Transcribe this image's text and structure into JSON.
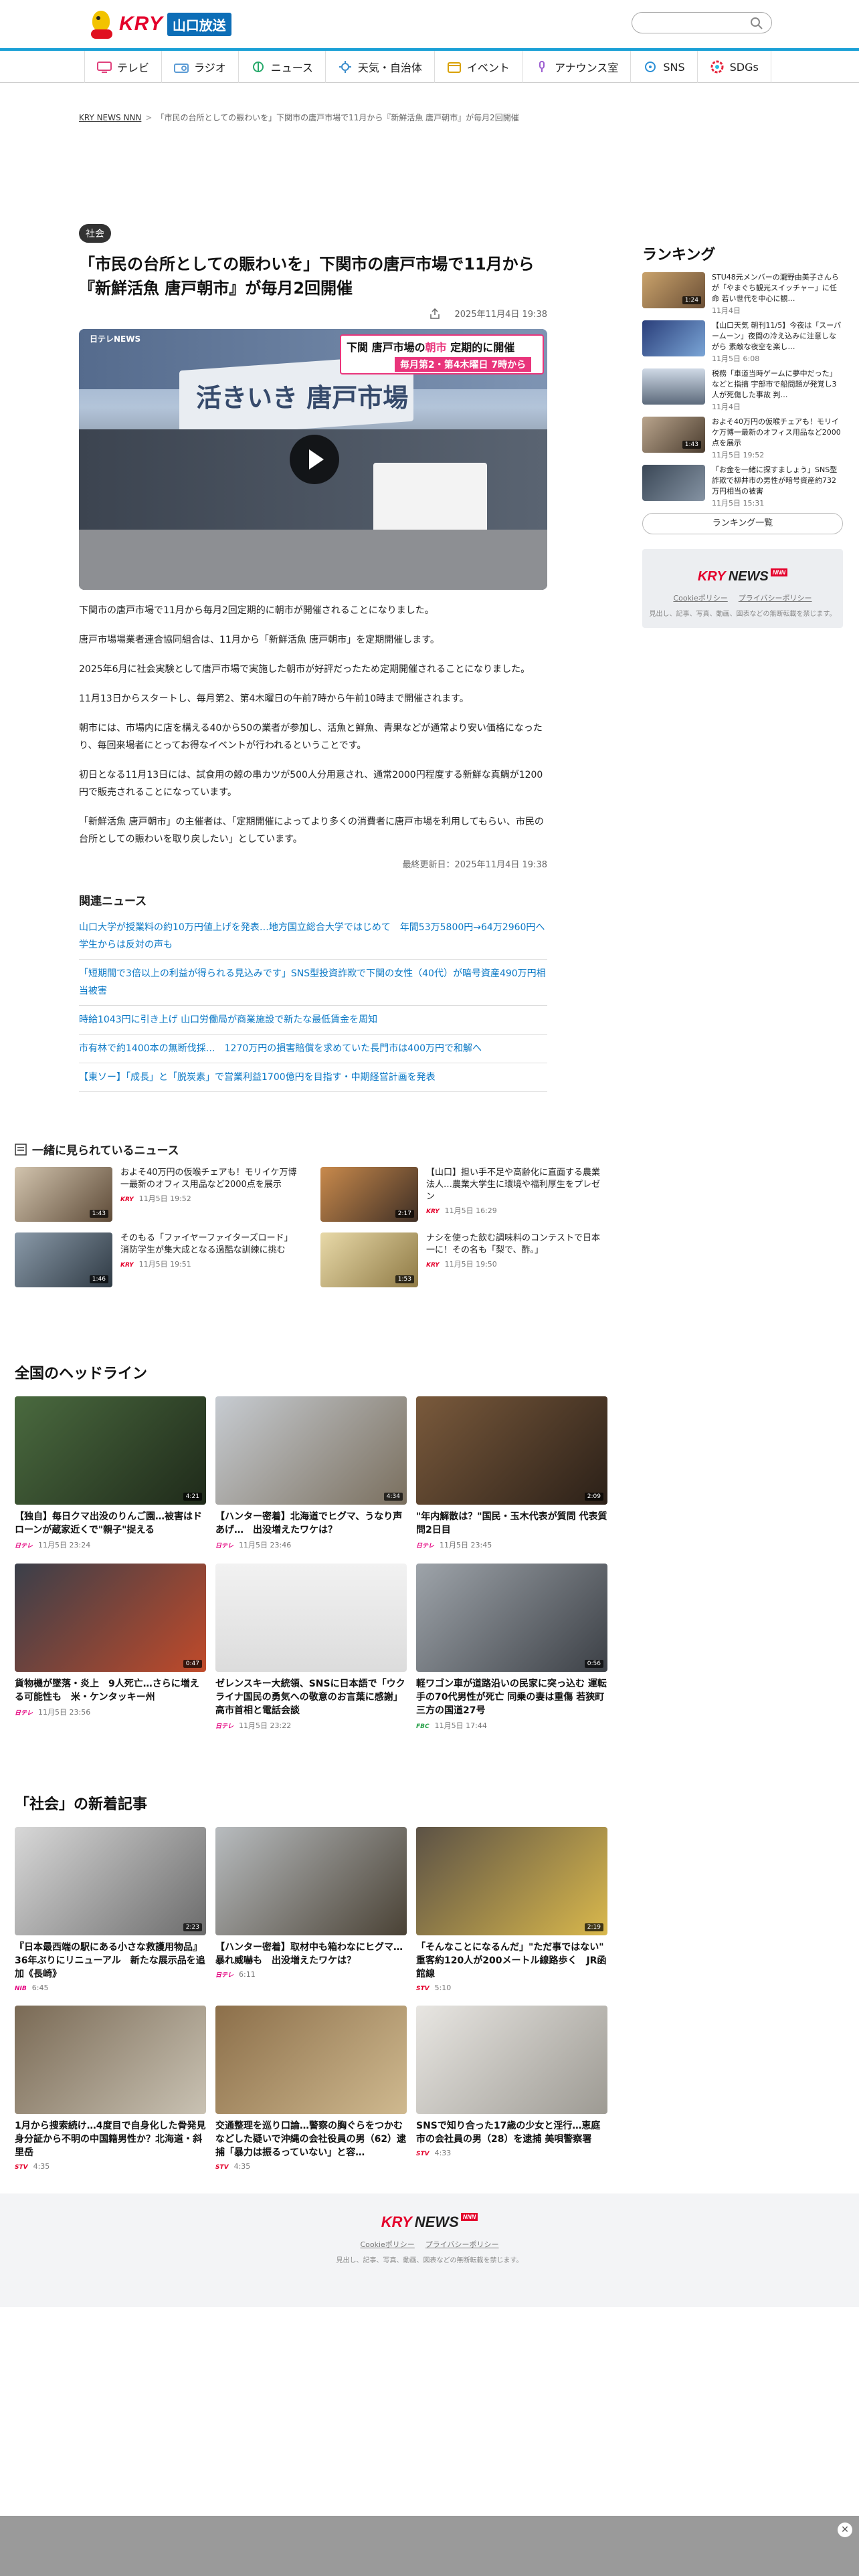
{
  "header": {
    "logo_text": "KRY",
    "logo_sub": "山口放送",
    "search_placeholder": ""
  },
  "nav": [
    {
      "label": "テレビ",
      "icon": "tv-icon"
    },
    {
      "label": "ラジオ",
      "icon": "radio-icon"
    },
    {
      "label": "ニュース",
      "icon": "news-icon"
    },
    {
      "label": "天気・自治体",
      "icon": "weather-icon"
    },
    {
      "label": "イベント",
      "icon": "event-icon"
    },
    {
      "label": "アナウンス室",
      "icon": "mic-icon"
    },
    {
      "label": "SNS",
      "icon": "sns-icon"
    },
    {
      "label": "SDGs",
      "icon": "sdgs-icon"
    }
  ],
  "breadcrumb": {
    "home": "KRY NEWS NNN",
    "current": "「市民の台所としての賑わいを」下関市の唐戸市場で11月から『新鮮活魚 唐戸朝市』が毎月2回開催"
  },
  "article": {
    "category": "社会",
    "title": "「市民の台所としての賑わいを」下関市の唐戸市場で11月から『新鮮活魚 唐戸朝市』が毎月2回開催",
    "date": "2025年11月4日 19:38",
    "video": {
      "brand": "日テレNEWS",
      "sign_text": "活きいき 唐戸市場",
      "banner_prefix": "唐戸市場の",
      "banner_highlight": "朝市",
      "banner_suffix": "定期的に開催",
      "banner_sub": "毎月第2・第4木曜日 7時から",
      "banner_tag": "下関"
    },
    "paragraphs": [
      "下関市の唐戸市場で11月から毎月2回定期的に朝市が開催されることになりました。",
      "唐戸市場場業者連合協同組合は、11月から「新鮮活魚 唐戸朝市」を定期開催します。",
      "2025年6月に社会実験として唐戸市場で実施した朝市が好評だったため定期開催されることになりました。",
      "11月13日からスタートし、毎月第2、第4木曜日の午前7時から午前10時まで開催されます。",
      "朝市には、市場内に店を構える40から50の業者が参加し、活魚と鮮魚、青果などが通常より安い価格になったり、毎回来場者にとってお得なイベントが行われるということです。",
      "初日となる11月13日には、試食用の鯨の串カツが500人分用意され、通常2000円程度する新鮮な真鯛が1200円で販売されることになっています。",
      "「新鮮活魚 唐戸朝市」の主催者は、「定期開催によってより多くの消費者に唐戸市場を利用してもらい、市民の台所としての賑わいを取り戻したい」としています。"
    ],
    "updated": "最終更新日：2025年11月4日 19:38"
  },
  "related": {
    "heading": "関連ニュース",
    "items": [
      "山口大学が授業料の約10万円値上げを発表…地方国立総合大学ではじめて　年間53万5800円→64万2960円へ　学生からは反対の声も",
      "「短期間で3倍以上の利益が得られる見込みです」SNS型投資詐欺で下関の女性（40代）が暗号資産490万円相当被害",
      "時給1043円に引き上げ 山口労働局が商業施設で新たな最低賃金を周知",
      "市有林で約1400本の無断伐採…　1270万円の損害賠償を求めていた長門市は400万円で和解へ",
      "【東ソー】「成長」と「脱炭素」で営業利益1700億円を目指す・中期経営計画を発表"
    ]
  },
  "ranking": {
    "heading": "ランキング",
    "items": [
      {
        "title": "STU48元メンバーの瀧野由美子さんらが「やまぐち観光スイッチャー」に任命 若い世代を中心に観…",
        "date": "11月4日",
        "duration": "1:24"
      },
      {
        "title": "【山口天気 朝刊11/5】今夜は「スーパームーン」夜間の冷え込みに注意しながら 素敵な夜空を楽し…",
        "date": "11月5日 6:08",
        "duration": ""
      },
      {
        "title": "税務「車道当時ゲームに夢中だった」などと指摘 宇部市で船問題が発覚し3人が死傷した事故 判…",
        "date": "11月4日",
        "duration": ""
      },
      {
        "title": "およそ40万円の仮喉チェアも！モリイケ万博一最新のオフィス用品など2000点を展示",
        "date": "11月5日 19:52",
        "duration": "1:43"
      },
      {
        "title": "「お金を一緒に探すましょう」SNS型詐欺で柳井市の男性が暗号資産約732万円相当の被害",
        "date": "11月5日 15:31",
        "duration": ""
      }
    ],
    "more_label": "ランキング一覧"
  },
  "sidebox": {
    "logo_main": "KRY",
    "logo_news": "NEWS",
    "logo_tag": "NNN",
    "link1": "Cookieポリシー",
    "link2": "プライバシーポリシー",
    "copy": "見出し、記事、写真、動画、図表などの無断転載を禁じます。"
  },
  "seen": {
    "heading": "一緒に見られているニュース",
    "items": [
      {
        "title": "およそ40万円の仮喉チェアも！モリイケ万博一最新のオフィス用品など2000点を展示",
        "src": "KRY",
        "date": "11月5日 19:52",
        "duration": "1:43"
      },
      {
        "title": "【山口】担い手不足や高齢化に直面する農業法人…農業大学生に環境や福利厚生をプレゼン",
        "src": "KRY",
        "date": "11月5日 16:29",
        "duration": "2:17"
      },
      {
        "title": "そのもる「ファイヤーファイターズロード」消防学生が集大成となる過酷な訓練に挑む",
        "src": "KRY",
        "date": "11月5日 19:51",
        "duration": "1:46"
      },
      {
        "title": "ナシを使った飲む調味料のコンテストで日本一に！その名も「梨で、酢。」",
        "src": "KRY",
        "date": "11月5日 19:50",
        "duration": "1:53"
      }
    ]
  },
  "headlines": {
    "heading": "全国のヘッドライン",
    "items": [
      {
        "title": "【独自】毎日クマ出没のりんご園…被害はドローンが蔵家近くで\"親子\"捉える",
        "src": "日テレ",
        "date": "11月5日 23:24",
        "duration": "4:21"
      },
      {
        "title": "【ハンター密着】北海道でヒグマ、うなり声あげ…　出没増えたワケは？",
        "src": "日テレ",
        "date": "11月5日 23:46",
        "duration": "4:34"
      },
      {
        "title": "\"年内解散は？\"国民・玉木代表が質問 代表質問2日目",
        "src": "日テレ",
        "date": "11月5日 23:45",
        "duration": "2:09"
      },
      {
        "title": "貨物機が墜落・炎上　9人死亡…さらに増える可能性も　米・ケンタッキー州",
        "src": "日テレ",
        "date": "11月5日 23:56",
        "duration": "0:47"
      },
      {
        "title": "ゼレンスキー大統領、SNSに日本語で「ウクライナ国民の勇気への敬意のお言葉に感謝」高市首相と電話会談",
        "src": "日テレ",
        "date": "11月5日 23:22",
        "duration": ""
      },
      {
        "title": "軽ワゴン車が道路沿いの民家に突っ込む 運転手の70代男性が死亡 同乗の妻は重傷 若狭町三方の国道27号",
        "src": "FBC",
        "date": "11月5日 17:44",
        "duration": "0:56"
      }
    ]
  },
  "social": {
    "heading": "「社会」の新着記事",
    "items": [
      {
        "title": "『日本最西端の駅にある小さな救護用物品』36年ぶりにリニューアル　新たな展示品を追加《長崎》",
        "src": "NIB",
        "date": "6:45",
        "duration": "2:23"
      },
      {
        "title": "【ハンター密着】取材中も箱わなにヒグマ…暴れ威嚇も　出没増えたワケは？",
        "src": "日テレ",
        "date": "6:11",
        "duration": ""
      },
      {
        "title": "「そんなことになるんだ」\"ただ事ではない\" 重客約120人が200メートル線路歩く　JR函館線",
        "src": "STV",
        "date": "5:10",
        "duration": "2:19"
      },
      {
        "title": "1月から捜索続け…4度目で自身化した骨発見　身分証から不明の中国籍男性か？北海道・斜里岳",
        "src": "STV",
        "date": "4:35",
        "duration": ""
      },
      {
        "title": "交通整理を巡り口論…警察の胸ぐらをつかむなどした疑いで沖縄の会社役員の男（62）逮捕「暴力は振るっていない」と容…",
        "src": "STV",
        "date": "4:35",
        "duration": ""
      },
      {
        "title": "SNSで知り合った17歳の少女と淫行…恵庭市の会社員の男（28）を逮捕 美唄警察署",
        "src": "STV",
        "date": "4:33",
        "duration": ""
      }
    ]
  },
  "footer": {
    "logo_main": "KRY",
    "logo_news": "NEWS",
    "logo_tag": "NNN",
    "link1": "Cookieポリシー",
    "link2": "プライバシーポリシー",
    "copy": "見出し、記事、写真、動画、図表などの無断転載を禁じます。"
  },
  "colors": {
    "brand_red": "#e4002b",
    "nav_accent": "#1aa0d6",
    "link_blue": "#0b79c6"
  }
}
